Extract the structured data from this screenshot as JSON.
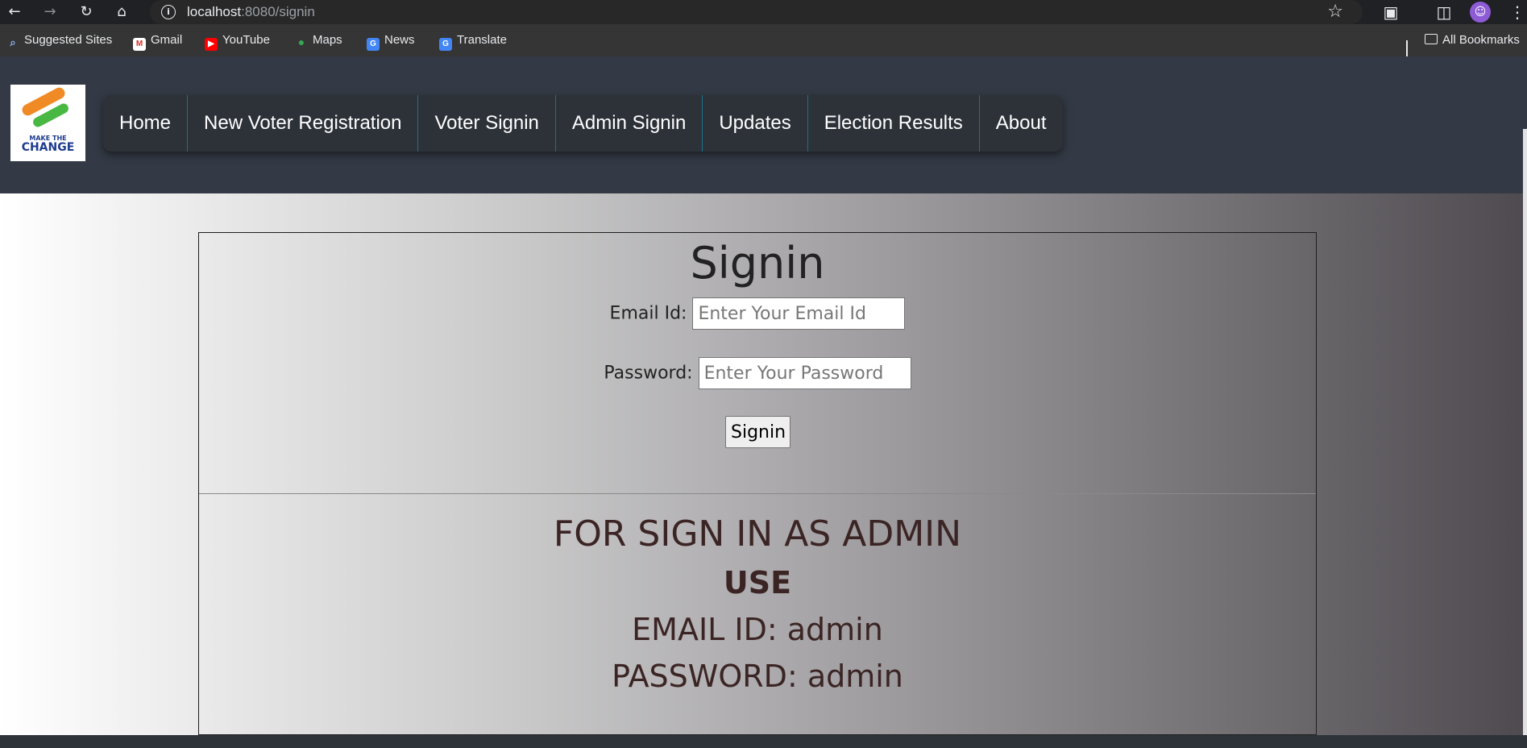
{
  "browser": {
    "url_host": "localhost",
    "url_rest": ":8080/signin",
    "bookmarks": [
      {
        "label": "Suggested Sites",
        "icon": "search-icon"
      },
      {
        "label": "Gmail",
        "icon": "gmail-icon"
      },
      {
        "label": "YouTube",
        "icon": "youtube-icon"
      },
      {
        "label": "Maps",
        "icon": "maps-icon"
      },
      {
        "label": "News",
        "icon": "news-icon"
      },
      {
        "label": "Translate",
        "icon": "translate-icon"
      }
    ],
    "all_bookmarks": "All Bookmarks"
  },
  "site": {
    "logo_text_top": "MAKE THE",
    "logo_text_main": "CHANGE",
    "nav": [
      "Home",
      "New Voter Registration",
      "Voter Signin",
      "Admin Signin",
      "Updates",
      "Election Results",
      "About"
    ]
  },
  "signin": {
    "title": "Signin",
    "email_label": "Email Id:",
    "email_placeholder": "Enter Your Email Id",
    "password_label": "Password:",
    "password_placeholder": "Enter Your Password",
    "button": "Signin"
  },
  "admin_info": {
    "line1": "FOR SIGN IN AS ADMIN",
    "line2": "USE",
    "line3": "EMAIL ID: admin",
    "line4": "PASSWORD: admin"
  },
  "colors": {
    "header_bg": "#343a45",
    "nav_divider": "#1f6f8b",
    "admin_text": "#3b2424"
  }
}
